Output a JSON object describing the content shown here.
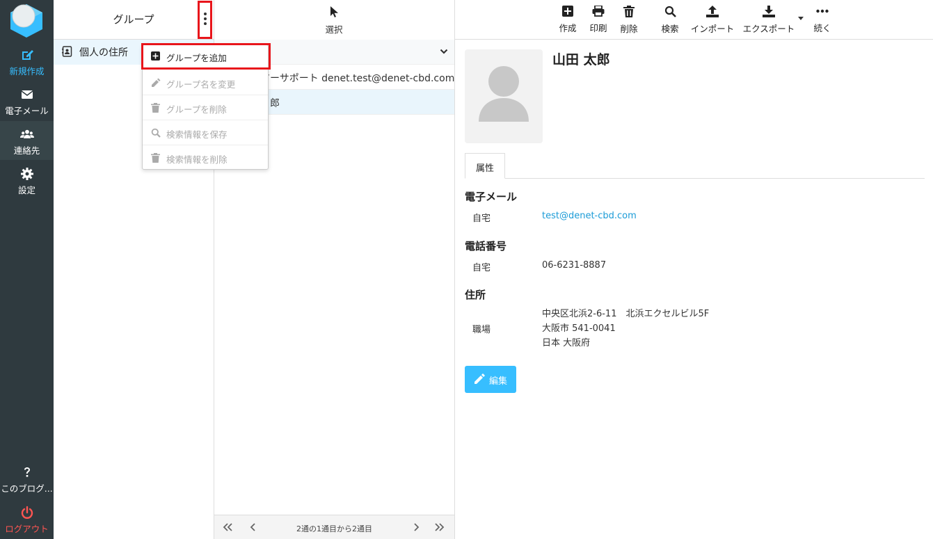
{
  "nav": {
    "compose": "新規作成",
    "mail": "電子メール",
    "contacts": "連絡先",
    "settings": "設定",
    "about": "このブログ...",
    "logout": "ログアウト"
  },
  "groups": {
    "title": "グループ",
    "items": [
      {
        "label": "個人の住所"
      }
    ]
  },
  "group_menu": {
    "items": [
      {
        "label": "グループを追加",
        "icon": "plus-square-icon",
        "enabled": true
      },
      {
        "label": "グループ名を変更",
        "icon": "pencil-icon",
        "enabled": false
      },
      {
        "label": "グループを削除",
        "icon": "trash-icon",
        "enabled": false
      },
      {
        "label": "検索情報を保存",
        "icon": "search-icon",
        "enabled": false
      },
      {
        "label": "検索情報を削除",
        "icon": "trash-icon",
        "enabled": false
      }
    ]
  },
  "list": {
    "select_label": "選択",
    "contacts": [
      {
        "label": "マーサポート denet.test@denet-cbd.com"
      },
      {
        "label": "郎"
      }
    ],
    "pager": "2通の1通目から2通目"
  },
  "toolbar": {
    "create": "作成",
    "print": "印刷",
    "delete": "削除",
    "search": "検索",
    "import": "インポート",
    "export": "エクスポート",
    "more": "続く"
  },
  "contact": {
    "name": "山田 太郎",
    "tab": "属性",
    "email_title": "電子メール",
    "email_label": "自宅",
    "email_value": "test@denet-cbd.com",
    "phone_title": "電話番号",
    "phone_label": "自宅",
    "phone_value": "06-6231-8887",
    "address_title": "住所",
    "address_label": "職場",
    "address_line1": "中央区北浜2-6-11　北浜エクセルビル5F",
    "address_line2": "大阪市 541-0041",
    "address_line3": "日本 大阪府",
    "edit": "編集"
  },
  "colors": {
    "accent": "#37beff",
    "sidebar": "#2f3a3f",
    "highlight": "#e8151b",
    "logout": "#ff5552"
  }
}
